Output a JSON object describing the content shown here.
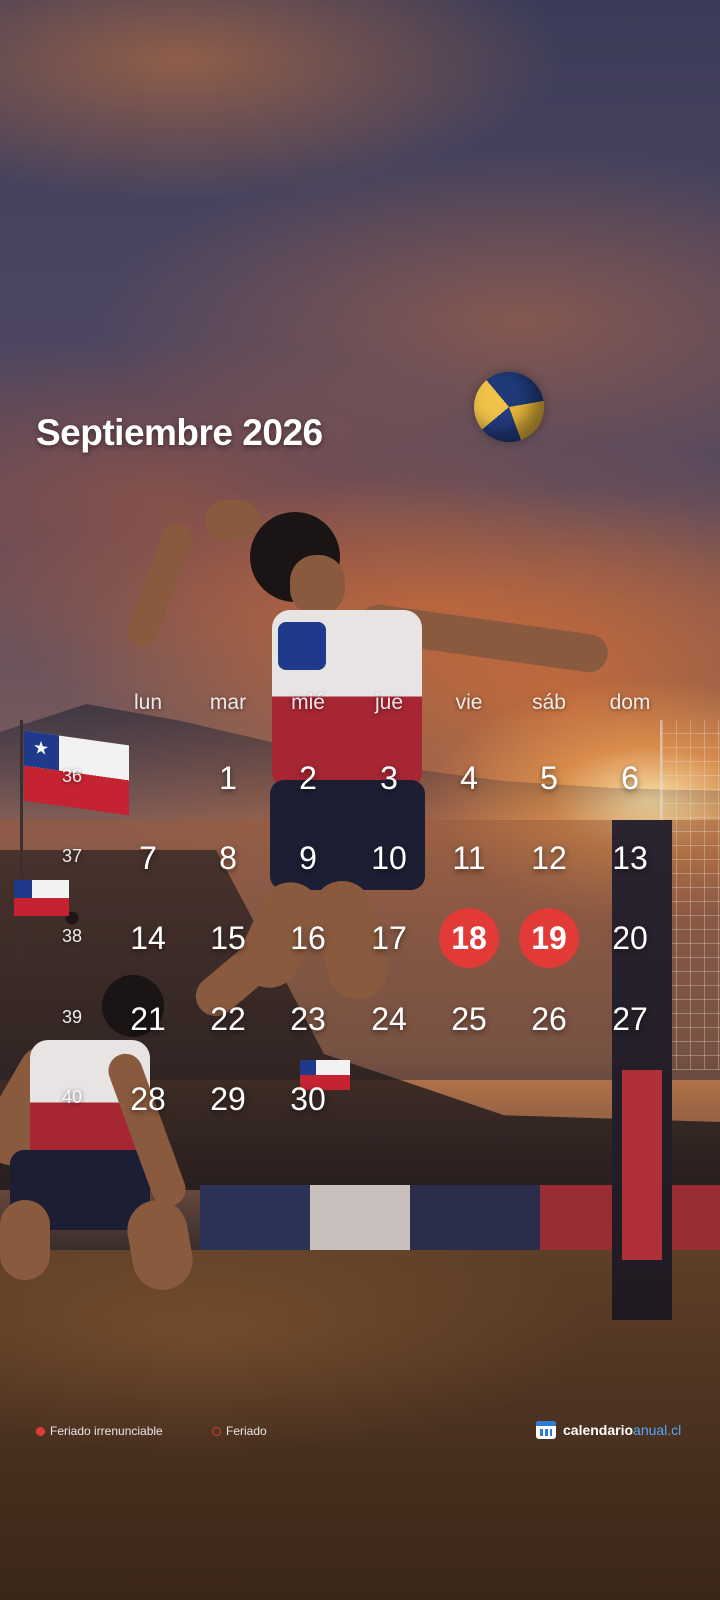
{
  "calendar": {
    "title": "Septiembre 2026",
    "weekdays": [
      "lun",
      "mar",
      "mié",
      "jue",
      "vie",
      "sáb",
      "dom"
    ],
    "weeks": [
      {
        "number": "36",
        "days": [
          "",
          "1",
          "2",
          "3",
          "4",
          "5",
          "6"
        ]
      },
      {
        "number": "37",
        "days": [
          "7",
          "8",
          "9",
          "10",
          "11",
          "12",
          "13"
        ]
      },
      {
        "number": "38",
        "days": [
          "14",
          "15",
          "16",
          "17",
          "18",
          "19",
          "20"
        ]
      },
      {
        "number": "39",
        "days": [
          "21",
          "22",
          "23",
          "24",
          "25",
          "26",
          "27"
        ]
      },
      {
        "number": "40",
        "days": [
          "28",
          "29",
          "30",
          "",
          "",
          "",
          ""
        ]
      }
    ],
    "holidays_irrenunciable": [
      "18",
      "19"
    ]
  },
  "legend": {
    "irrenunciable_label": "Feriado irrenunciable",
    "feriado_label": "Feriado"
  },
  "brand": {
    "name_main": "calendario",
    "name_accent": "anual.cl",
    "icon": "calendar-icon"
  },
  "colors": {
    "holiday": "#e23a36",
    "brand_accent": "#58a6ff"
  }
}
